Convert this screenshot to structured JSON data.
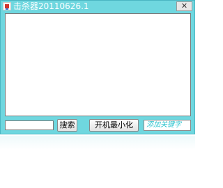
{
  "window": {
    "title": "击杀器20110626.1",
    "close_label": "✕"
  },
  "search": {
    "input_value": "",
    "button_label": "搜索"
  },
  "actions": {
    "minimize_label": "开机最小化"
  },
  "hint": {
    "text": "添加关键字"
  },
  "colors": {
    "window_bg": "#6fd7df",
    "hint_text": "#2ec4cf"
  }
}
